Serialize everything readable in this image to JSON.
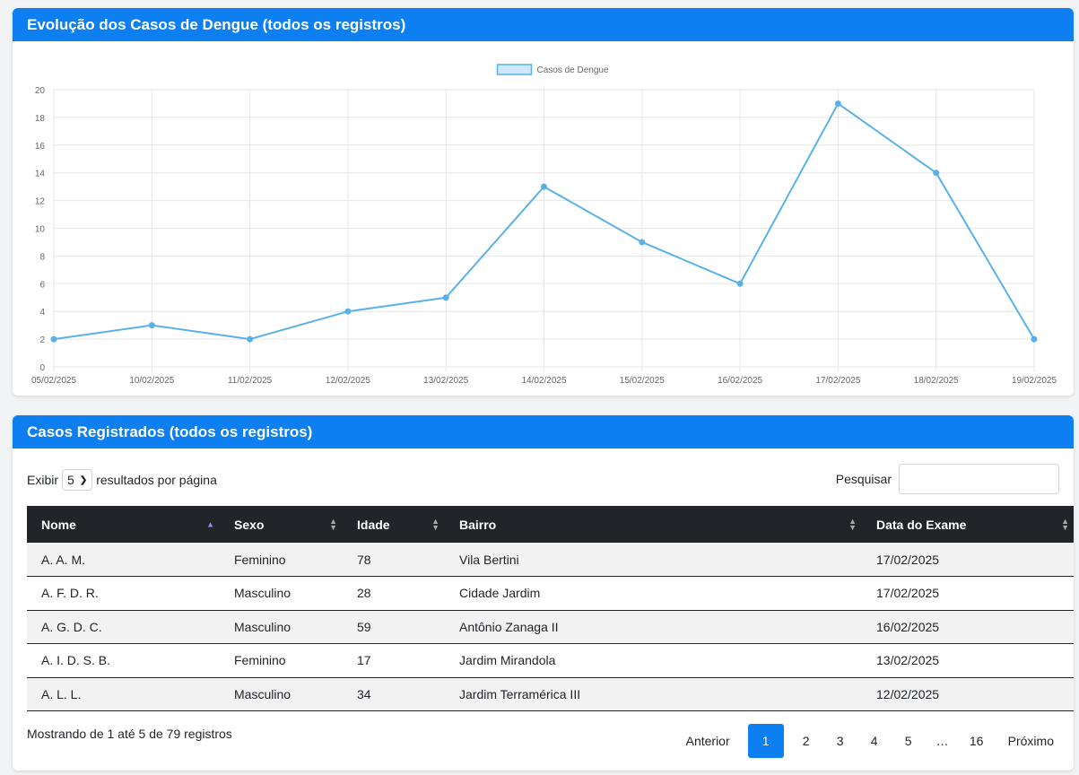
{
  "chart_card": {
    "title": "Evolução dos Casos de Dengue (todos os registros)"
  },
  "chart_data": {
    "type": "line",
    "categories": [
      "05/02/2025",
      "10/02/2025",
      "11/02/2025",
      "12/02/2025",
      "13/02/2025",
      "14/02/2025",
      "15/02/2025",
      "16/02/2025",
      "17/02/2025",
      "18/02/2025",
      "19/02/2025"
    ],
    "series": [
      {
        "name": "Casos de Dengue",
        "values": [
          2,
          3,
          2,
          4,
          5,
          13,
          9,
          6,
          19,
          14,
          2
        ]
      }
    ],
    "ylim": [
      0,
      20
    ],
    "yticks": [
      0,
      2,
      4,
      6,
      8,
      10,
      12,
      14,
      16,
      18,
      20
    ],
    "grid": true,
    "legend": "top-center",
    "color": "#5ab1e8",
    "fill_color": "#cfe7f8"
  },
  "table_card": {
    "title": "Casos Registrados (todos os registros)",
    "show_prefix": "Exibir",
    "page_size": "5",
    "show_suffix": "resultados por página",
    "search_label": "Pesquisar",
    "search_value": "",
    "columns": [
      "Nome",
      "Sexo",
      "Idade",
      "Bairro",
      "Data do Exame"
    ],
    "rows": [
      [
        "A. A. M.",
        "Feminino",
        "78",
        "Vila Bertini",
        "17/02/2025"
      ],
      [
        "A. F. D. R.",
        "Masculino",
        "28",
        "Cidade Jardim",
        "17/02/2025"
      ],
      [
        "A. G. D. C.",
        "Masculino",
        "59",
        "Antônio Zanaga II",
        "16/02/2025"
      ],
      [
        "A. I. D. S. B.",
        "Feminino",
        "17",
        "Jardim Mirandola",
        "13/02/2025"
      ],
      [
        "A. L. L.",
        "Masculino",
        "34",
        "Jardim Terramérica III",
        "12/02/2025"
      ]
    ],
    "info": "Mostrando de 1 até 5 de 79 registros",
    "pagination": {
      "prev": "Anterior",
      "pages": [
        "1",
        "2",
        "3",
        "4",
        "5",
        "…",
        "16"
      ],
      "active": "1",
      "next": "Próximo"
    }
  },
  "icons": {
    "select": "chevron-down-icon",
    "sort": "sort-icon",
    "sort_asc": "sort-asc-icon"
  }
}
